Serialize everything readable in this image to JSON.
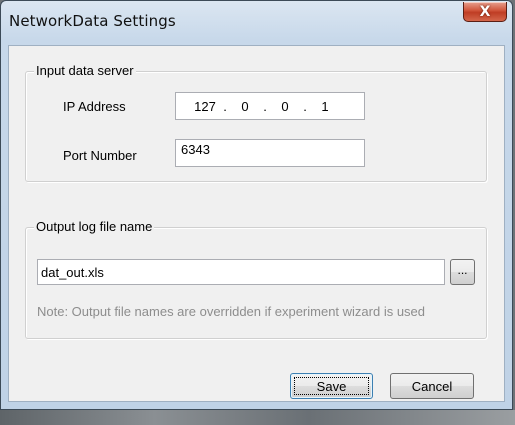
{
  "window": {
    "title": "NetworkData Settings",
    "close_glyph": "X"
  },
  "input_group": {
    "legend": "Input data server",
    "ip_label": "IP Address",
    "ip_octets": [
      "127",
      "0",
      "0",
      "1"
    ],
    "ip_separator": ".",
    "port_label": "Port Number",
    "port_value": "6343"
  },
  "output_group": {
    "legend": "Output log file name",
    "file_value": "dat_out.xls",
    "browse_label": "...",
    "note": "Note: Output file names are overridden if experiment wizard is used"
  },
  "buttons": {
    "save": "Save",
    "cancel": "Cancel"
  },
  "colors": {
    "close_button": "#c9472d",
    "note_text": "#8d8d8d",
    "default_button_border": "#3c7fb1"
  }
}
